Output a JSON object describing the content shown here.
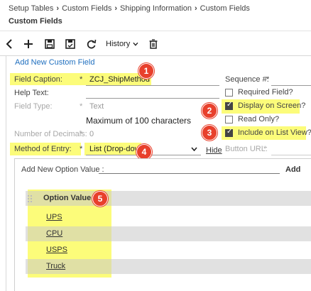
{
  "breadcrumb": [
    "Setup Tables",
    "Custom Fields",
    "Shipping Information",
    "Custom Fields"
  ],
  "page_title": "Custom Fields",
  "toolbar": {
    "history_label": "History"
  },
  "section_title": "Add New Custom Field",
  "form": {
    "field_caption_label": "Field Caption:",
    "field_caption_value": "ZCJ_ShipMethod",
    "help_text_label": "Help Text:",
    "field_type_label": "Field Type:",
    "field_type_value": "Text",
    "max_chars_note": "Maximum of 100 characters",
    "decimals_label": "Number of Decimals:",
    "decimals_value": "0",
    "method_label": "Method of Entry:",
    "method_value": "List (Drop-down)",
    "hide_link": "Hide",
    "required_marker": "*"
  },
  "right": {
    "sequence_label": "Sequence #:",
    "required_field": "Required Field?",
    "display_on_screen": "Display on Screen?",
    "read_only": "Read Only?",
    "include_list_view": "Include on List View?",
    "button_url_label": "Button URL:"
  },
  "checkboxes": {
    "required_field": false,
    "display_on_screen": true,
    "read_only": false,
    "include_list_view": true
  },
  "options": {
    "add_label": "Add New Option Value :",
    "add_button": "Add",
    "header": "Option Value",
    "values": [
      "UPS",
      "CPU",
      "USPS",
      "Truck"
    ]
  },
  "badges": [
    "1",
    "2",
    "3",
    "4",
    "5"
  ],
  "colors": {
    "highlight": "#fcfc7a",
    "badge": "#e8402c",
    "section_title": "#1f6fbf"
  },
  "icons": [
    "back-arrow-icon",
    "plus-icon",
    "save-icon",
    "save-close-icon",
    "refresh-icon",
    "chevron-down-icon",
    "trash-icon"
  ]
}
